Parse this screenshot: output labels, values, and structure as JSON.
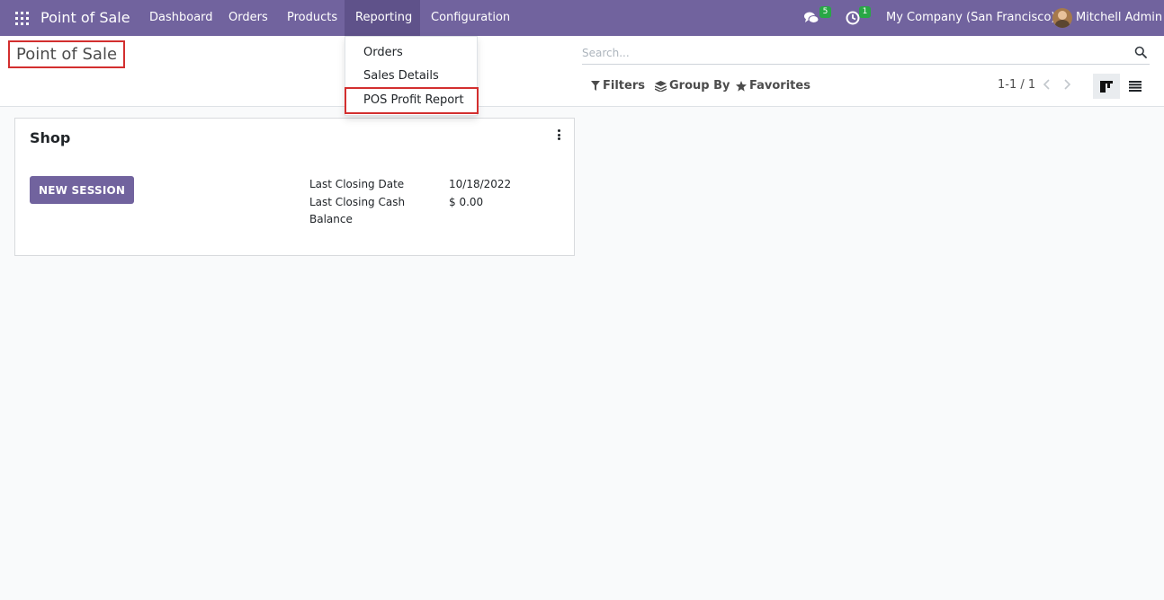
{
  "navbar": {
    "brand": "Point of Sale",
    "items": [
      "Dashboard",
      "Orders",
      "Products",
      "Reporting",
      "Configuration"
    ],
    "active": "Reporting",
    "messages_badge": "5",
    "activities_badge": "1",
    "company": "My Company (San Francisco)",
    "user": "Mitchell Admin"
  },
  "control_panel": {
    "title": "Point of Sale",
    "search_placeholder": "Search...",
    "filters_label": "Filters",
    "group_by_label": "Group By",
    "favorites_label": "Favorites",
    "pager": "1-1 / 1"
  },
  "reporting_menu": {
    "items": [
      "Orders",
      "Sales Details",
      "POS Profit Report"
    ],
    "highlighted": "POS Profit Report"
  },
  "card": {
    "title": "Shop",
    "new_session_label": "NEW SESSION",
    "last_closing_date_label": "Last Closing Date",
    "last_closing_date_value": "10/18/2022",
    "last_closing_cash_label_1": "Last Closing Cash",
    "last_closing_cash_label_2": "Balance",
    "last_closing_cash_value": "$ 0.00"
  },
  "colors": {
    "navbar": "#71639e",
    "accent": "#71639e",
    "badge": "#28a745",
    "highlight_border": "#d32f2f"
  }
}
